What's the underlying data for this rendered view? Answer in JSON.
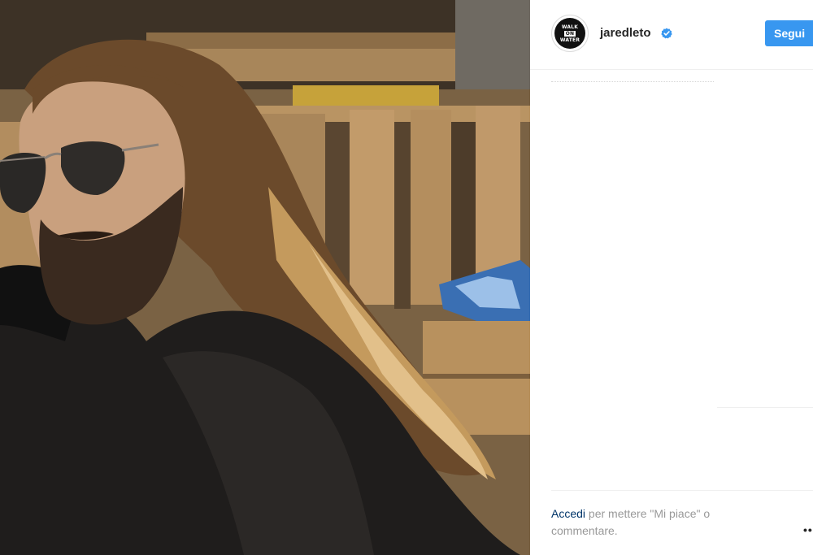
{
  "post": {
    "username": "jaredleto",
    "verified": true,
    "follow_label": "Segui",
    "avatar": {
      "icon": "walk-on-water-logo",
      "lines": [
        "WALK",
        "ON",
        "WATER"
      ]
    }
  },
  "footer": {
    "login_link": "Accedi",
    "login_rest": " per mettere \"Mi piace\" o commentare.",
    "more_icon": "more-options-icon"
  },
  "photo": {
    "description_icon": "post-photo"
  },
  "colors": {
    "accent": "#3897f0",
    "link": "#003569",
    "muted": "#999999",
    "verified": "#3897f0"
  }
}
